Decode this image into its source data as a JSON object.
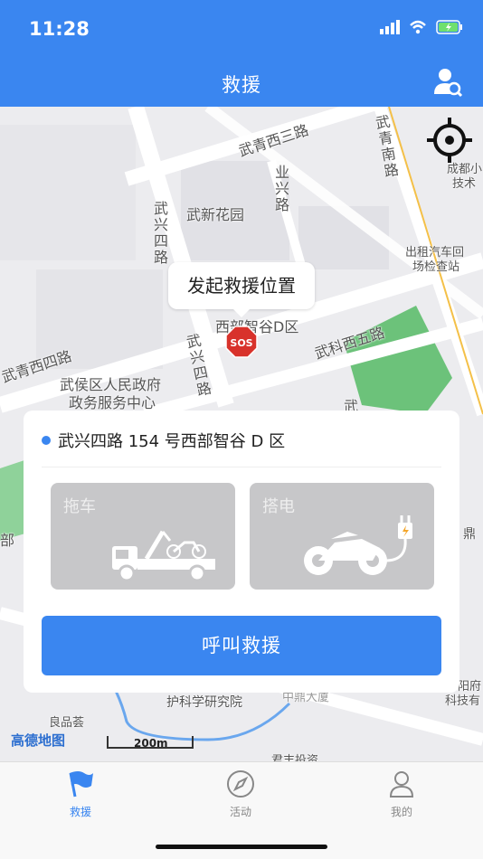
{
  "status_bar": {
    "time": "11:28"
  },
  "header": {
    "title": "救援"
  },
  "map": {
    "labels": {
      "wuqing_xi_san": "武青西三路",
      "wuqing_nan": "武青南路",
      "chengdu_tech": "成都小",
      "chengdu_tech2": "技术",
      "yexing": "业兴路",
      "wuxin_garden": "武新花园",
      "wuxing_si_top": "武兴四路",
      "taxi": "出租汽车回",
      "taxi2": "场检查站",
      "xibu_zhigu": "西部智谷D区",
      "wuke_xi_wu": "武科西五路",
      "wuqing_xi_si": "武青西四路",
      "wuxing_si_mid": "武兴四路",
      "wuhou_gov": "武侯区人民政府",
      "wuhou_gov2": "政务服务中心",
      "wu_small": "武",
      "bu": "部",
      "ding": "鼎",
      "hushi": "护科学研究院",
      "zhongding": "中鼎大厦",
      "fu": "阳府",
      "keji": "科技有",
      "junfeng": "君丰投资",
      "liangpin": "良品荟"
    },
    "bubble_text": "发起救援位置",
    "sos_text": "SOS",
    "logo_text": "高德地图",
    "scale_text": "200m"
  },
  "card": {
    "address": "武兴四路 154 号西部智谷 D 区",
    "services": [
      {
        "label": "拖车",
        "icon": "tow-truck-icon"
      },
      {
        "label": "搭电",
        "icon": "motorcycle-charge-icon"
      }
    ],
    "call_button": "呼叫救援"
  },
  "tabbar": {
    "tabs": [
      {
        "label": "救援",
        "icon": "flag-icon",
        "active": true
      },
      {
        "label": "活动",
        "icon": "compass-icon",
        "active": false
      },
      {
        "label": "我的",
        "icon": "person-icon",
        "active": false
      }
    ]
  },
  "colors": {
    "primary": "#3a86f0",
    "sos": "#d8322b",
    "park": "#6cc27a",
    "road": "#ffffff"
  }
}
